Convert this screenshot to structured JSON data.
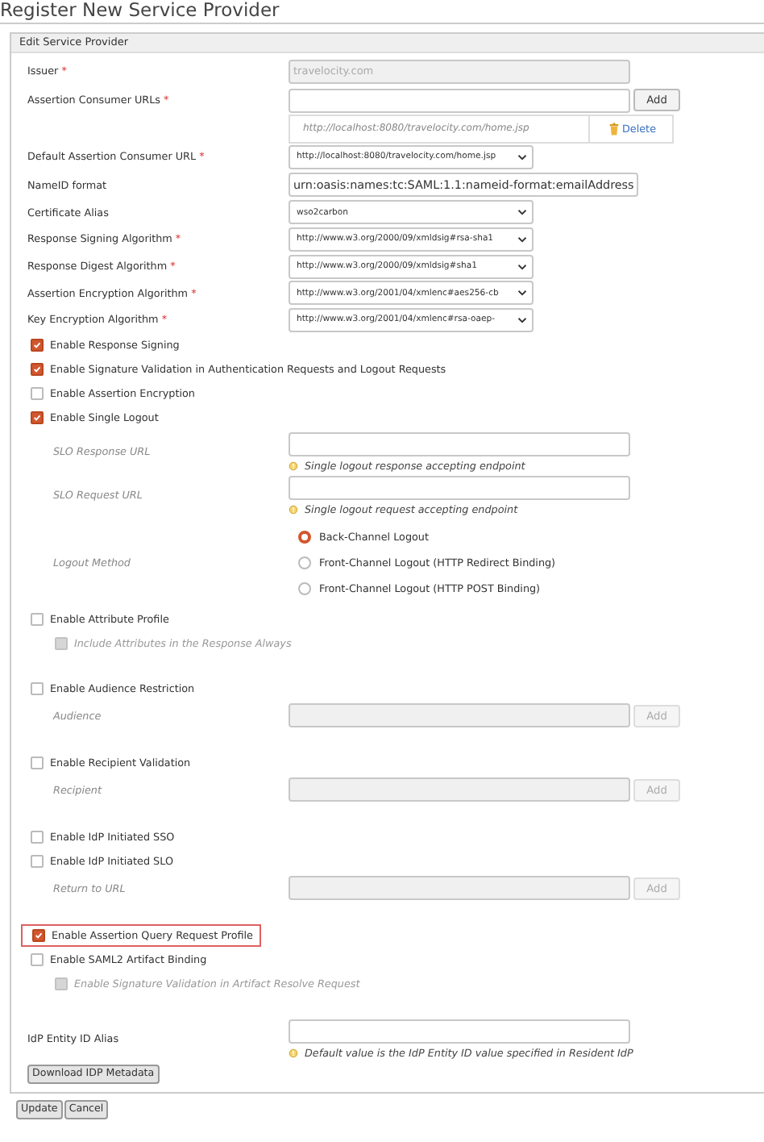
{
  "page_title": "Register New Service Provider",
  "panel": {
    "title": "Edit Service Provider",
    "groups": [
      {
        "rows": [
          {
            "kind": "field",
            "label": "Issuer",
            "required_mark": "*",
            "value": "travelocity.com",
            "disabled": true
          },
          {
            "kind": "field",
            "label": "Assertion Consumer URLs",
            "required_mark": "*",
            "disabled": false,
            "add_button": {
              "label": "Add",
              "disabled": false
            }
          },
          {
            "kind": "url_entry",
            "url": "http://localhost:8080/travelocity.com/home.jsp",
            "action": "Delete"
          },
          {
            "kind": "select",
            "label": "Default Assertion Consumer URL",
            "required_mark": "*",
            "value": "http://localhost:8080/travelocity.com/home.jsp"
          },
          {
            "kind": "field",
            "label": "NameID format",
            "value": "urn:oasis:names:tc:SAML:1.1:nameid-format:emailAddress",
            "disabled": false
          },
          {
            "kind": "select",
            "label": "Certificate Alias",
            "value": "wso2carbon"
          },
          {
            "kind": "select",
            "label": "Response Signing Algorithm",
            "required_mark": "*",
            "value": "http://www.w3.org/2000/09/xmldsig#rsa-sha1"
          },
          {
            "kind": "select",
            "label": "Response Digest Algorithm",
            "required_mark": "*",
            "value": "http://www.w3.org/2000/09/xmldsig#sha1"
          },
          {
            "kind": "select",
            "label": "Assertion Encryption Algorithm",
            "required_mark": "*",
            "value": "http://www.w3.org/2001/04/xmlenc#aes256-cb"
          },
          {
            "kind": "select",
            "label": "Key Encryption Algorithm",
            "required_mark": "*",
            "value": "http://www.w3.org/2001/04/xmlenc#rsa-oaep-"
          },
          {
            "kind": "checkbox",
            "label": "Enable Response Signing",
            "checked": true,
            "disabled": false
          },
          {
            "kind": "checkbox",
            "label": "Enable Signature Validation in Authentication Requests and Logout Requests",
            "checked": true,
            "disabled": false
          },
          {
            "kind": "checkbox",
            "label": "Enable Assertion Encryption",
            "checked": false,
            "disabled": false
          },
          {
            "kind": "checkbox",
            "label": "Enable Single Logout",
            "checked": true,
            "disabled": false
          },
          {
            "kind": "field",
            "label": "SLO Response URL",
            "sub": true,
            "hint": "Single logout response accepting endpoint",
            "disabled": false
          },
          {
            "kind": "field",
            "label": "SLO Request URL",
            "sub": true,
            "hint": "Single logout request accepting endpoint",
            "disabled": false
          },
          {
            "kind": "radio_group",
            "label": "Logout Method",
            "options": [
              {
                "label": "Back-Channel Logout",
                "selected": true
              },
              {
                "label": "Front-Channel Logout (HTTP Redirect Binding)",
                "selected": false
              },
              {
                "label": "Front-Channel Logout (HTTP POST Binding)",
                "selected": false
              }
            ]
          },
          {
            "kind": "checkbox",
            "label": "Enable Attribute Profile",
            "checked": false,
            "disabled": false
          },
          {
            "kind": "checkbox",
            "label": "Include Attributes in the Response Always",
            "checked": false,
            "disabled": true,
            "sub": true
          }
        ]
      },
      {
        "rows": [
          {
            "kind": "checkbox",
            "label": "Enable Audience Restriction",
            "checked": false,
            "disabled": false
          },
          {
            "kind": "field",
            "label": "Audience",
            "sub": true,
            "disabled": true,
            "add_button": {
              "label": "Add",
              "disabled": true
            }
          }
        ]
      },
      {
        "rows": [
          {
            "kind": "checkbox",
            "label": "Enable Recipient Validation",
            "checked": false,
            "disabled": false
          },
          {
            "kind": "field",
            "label": "Recipient",
            "sub": true,
            "disabled": true,
            "add_button": {
              "label": "Add",
              "disabled": true
            }
          }
        ]
      },
      {
        "rows": [
          {
            "kind": "checkbox",
            "label": "Enable IdP Initiated SSO",
            "checked": false,
            "disabled": false
          },
          {
            "kind": "checkbox",
            "label": "Enable IdP Initiated SLO",
            "checked": false,
            "disabled": false
          },
          {
            "kind": "field",
            "label": "Return to URL",
            "sub": true,
            "disabled": true,
            "add_button": {
              "label": "Add",
              "disabled": true
            }
          }
        ]
      },
      {
        "rows": [
          {
            "kind": "checkbox",
            "label": "Enable Assertion Query Request Profile",
            "checked": true,
            "disabled": false,
            "highlighted": true
          },
          {
            "kind": "checkbox",
            "label": "Enable SAML2 Artifact Binding",
            "checked": false,
            "disabled": false
          },
          {
            "kind": "checkbox",
            "label": "Enable Signature Validation in Artifact Resolve Request",
            "checked": false,
            "disabled": true,
            "sub": true
          }
        ]
      },
      {
        "rows": [
          {
            "kind": "field",
            "label": "IdP Entity ID Alias",
            "hint": "Default value is the IdP Entity ID value specified in Resident IdP",
            "disabled": false
          },
          {
            "kind": "button",
            "label": "Download IDP Metadata"
          }
        ]
      }
    ]
  },
  "buttons": [
    {
      "label": "Update"
    },
    {
      "label": "Cancel"
    }
  ]
}
